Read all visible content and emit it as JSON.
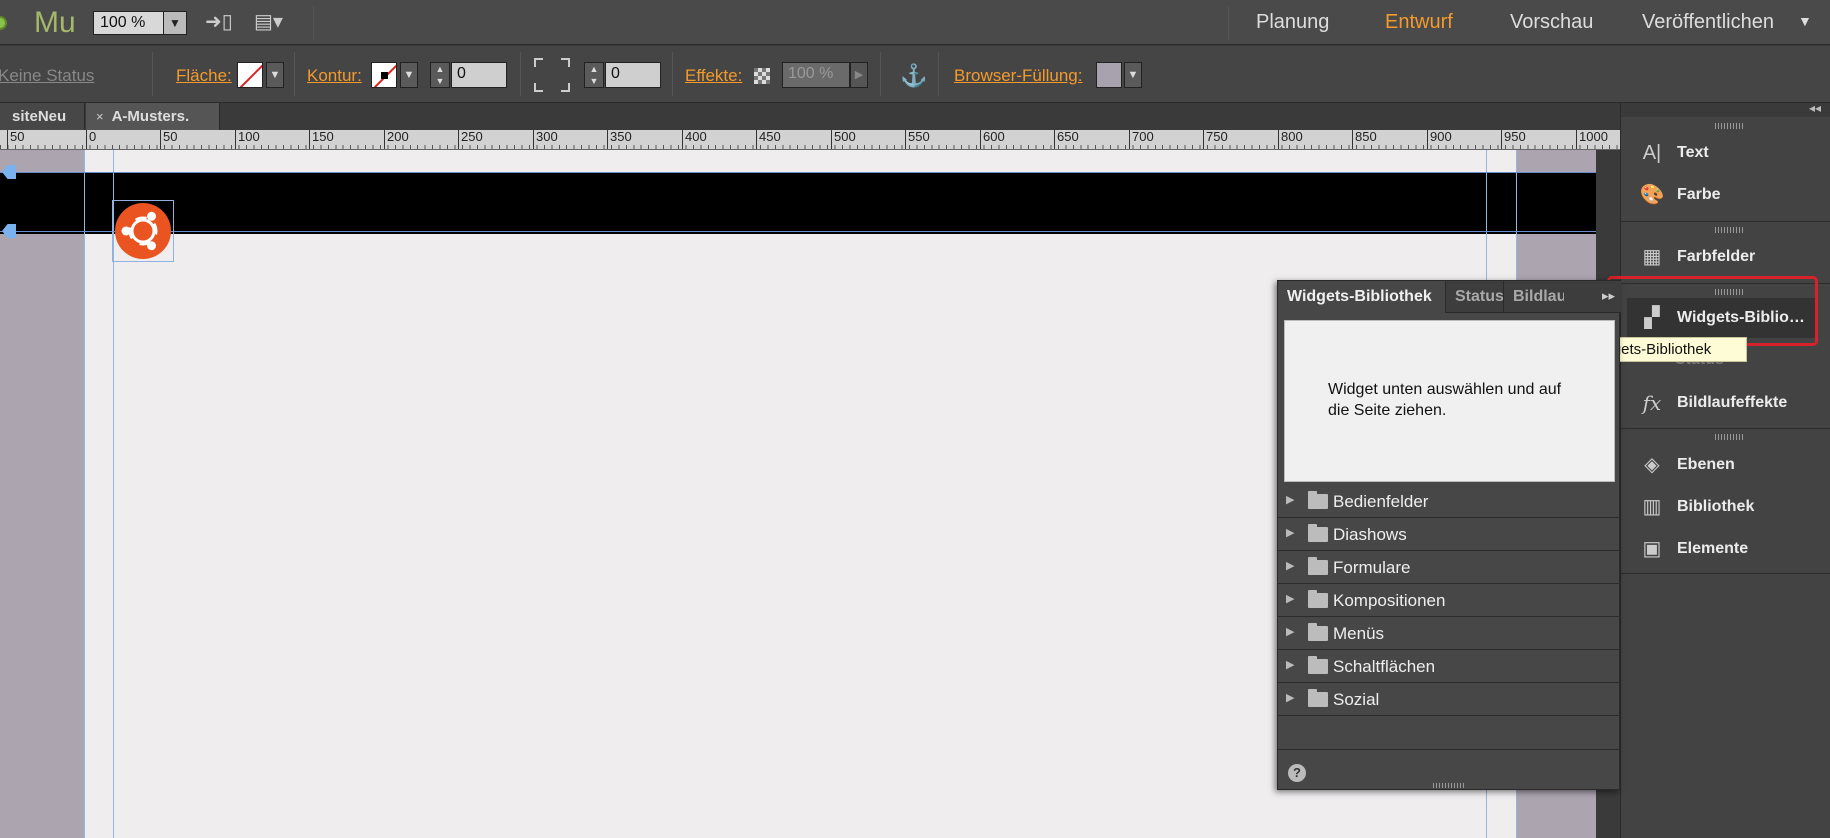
{
  "app": {
    "logo": "Mu",
    "zoom": "100 %"
  },
  "modes": {
    "planning": "Planung",
    "design": "Entwurf",
    "preview": "Vorschau",
    "publish": "Veröffentlichen"
  },
  "control": {
    "status": "Keine Status",
    "fill_label": "Fläche:",
    "stroke_label": "Kontur:",
    "stroke_width": "0",
    "corner_radius": "0",
    "effects_label": "Effekte:",
    "opacity": "100 %",
    "browser_fill_label": "Browser-Füllung:",
    "browser_fill_color": "#a8a2ae"
  },
  "tabs": [
    {
      "label": "siteNeu"
    },
    {
      "label": "A-Musters.",
      "close": "×"
    }
  ],
  "ruler": {
    "ticks": [
      "50",
      "0",
      "50",
      "100",
      "150",
      "200",
      "250",
      "300",
      "350",
      "400",
      "450",
      "500",
      "550",
      "600",
      "650",
      "700",
      "750",
      "800",
      "850",
      "900",
      "950",
      "1000"
    ]
  },
  "dock": {
    "items": [
      {
        "label": "Text",
        "icon": "text-icon"
      },
      {
        "label": "Farbe",
        "icon": "palette-icon"
      },
      {
        "label": "Farbfelder",
        "icon": "swatches-icon"
      },
      {
        "label": "Widgets-Biblio…",
        "icon": "widgets-icon"
      },
      {
        "label": "Bildlaufeffekte",
        "icon": "fx-icon"
      },
      {
        "label": "Ebenen",
        "icon": "layers-icon"
      },
      {
        "label": "Bibliothek",
        "icon": "library-icon"
      },
      {
        "label": "Elemente",
        "icon": "assets-icon"
      }
    ],
    "tooltip": "Widgets-Bibliothek",
    "hidden_item": "Status"
  },
  "widgets_panel": {
    "tabs": [
      "Widgets-Bibliothek",
      "Status",
      "Bildlau"
    ],
    "info": "Widget unten auswählen und auf die Seite ziehen.",
    "categories": [
      "Bedienfelder",
      "Diashows",
      "Formulare",
      "Kompositionen",
      "Menüs",
      "Schaltflächen",
      "Sozial"
    ],
    "help": "?"
  },
  "colors": {
    "accent": "#f39a2c",
    "logo_orange": "#e95420",
    "highlight_red": "#d6222a"
  }
}
